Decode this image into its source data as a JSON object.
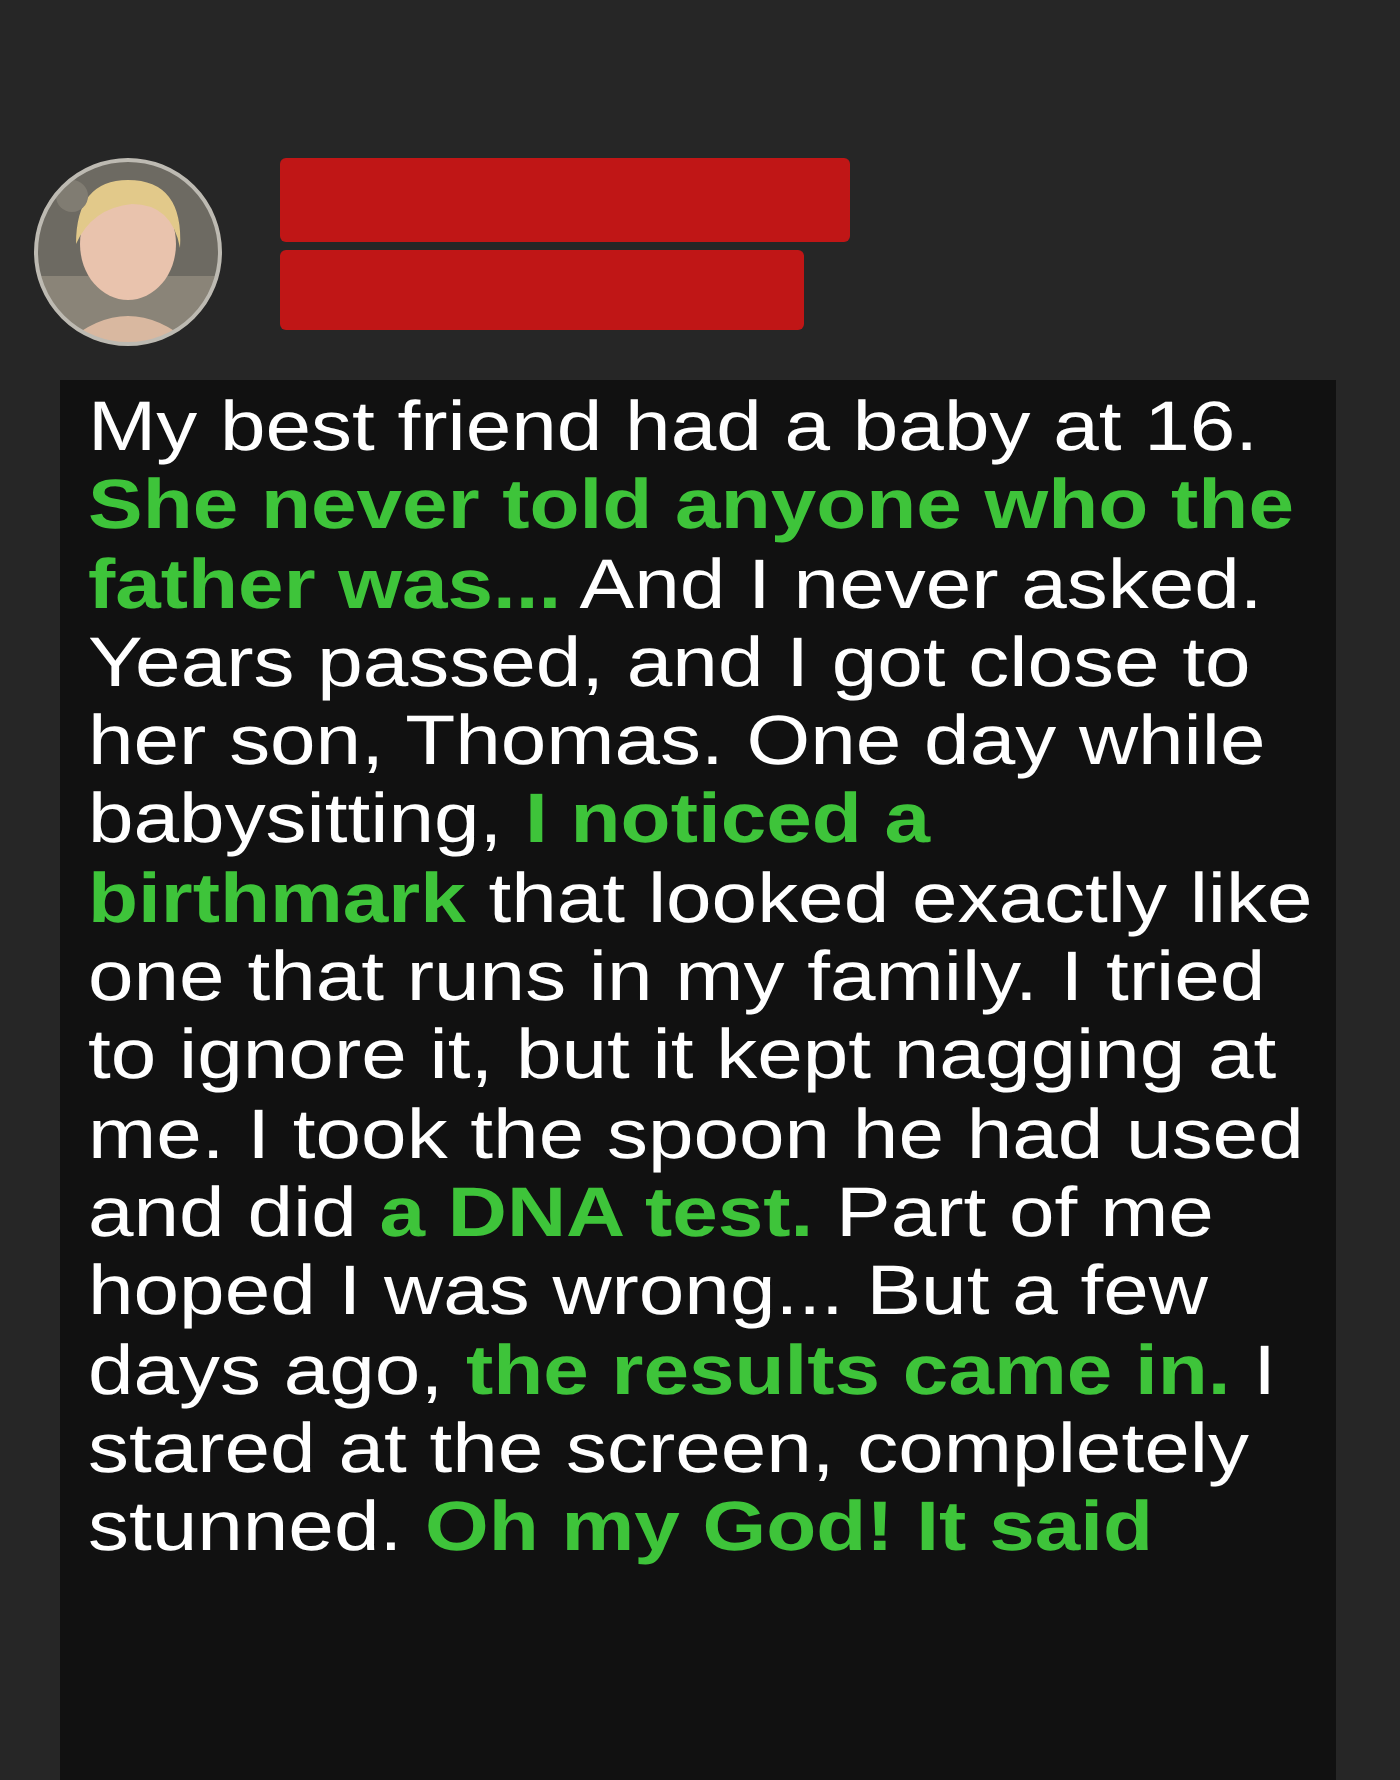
{
  "post": {
    "author": {
      "name_redacted": true
    },
    "text": "My best friend had a baby at 16. **She never told anyone who the father was...** And I never asked. Years passed, and I got close to her son, Thomas. One day while babysitting, **I noticed a birthmark** that looked exactly like one that runs in my family. I tried to ignore it, but it kept nagging at me. I took the spoon he had used and did **a DNA test.** Part of me hoped I was wrong... But a few days ago, **the results came in.** I stared at the screen, completely stunned. **Oh my God! It said**"
  }
}
